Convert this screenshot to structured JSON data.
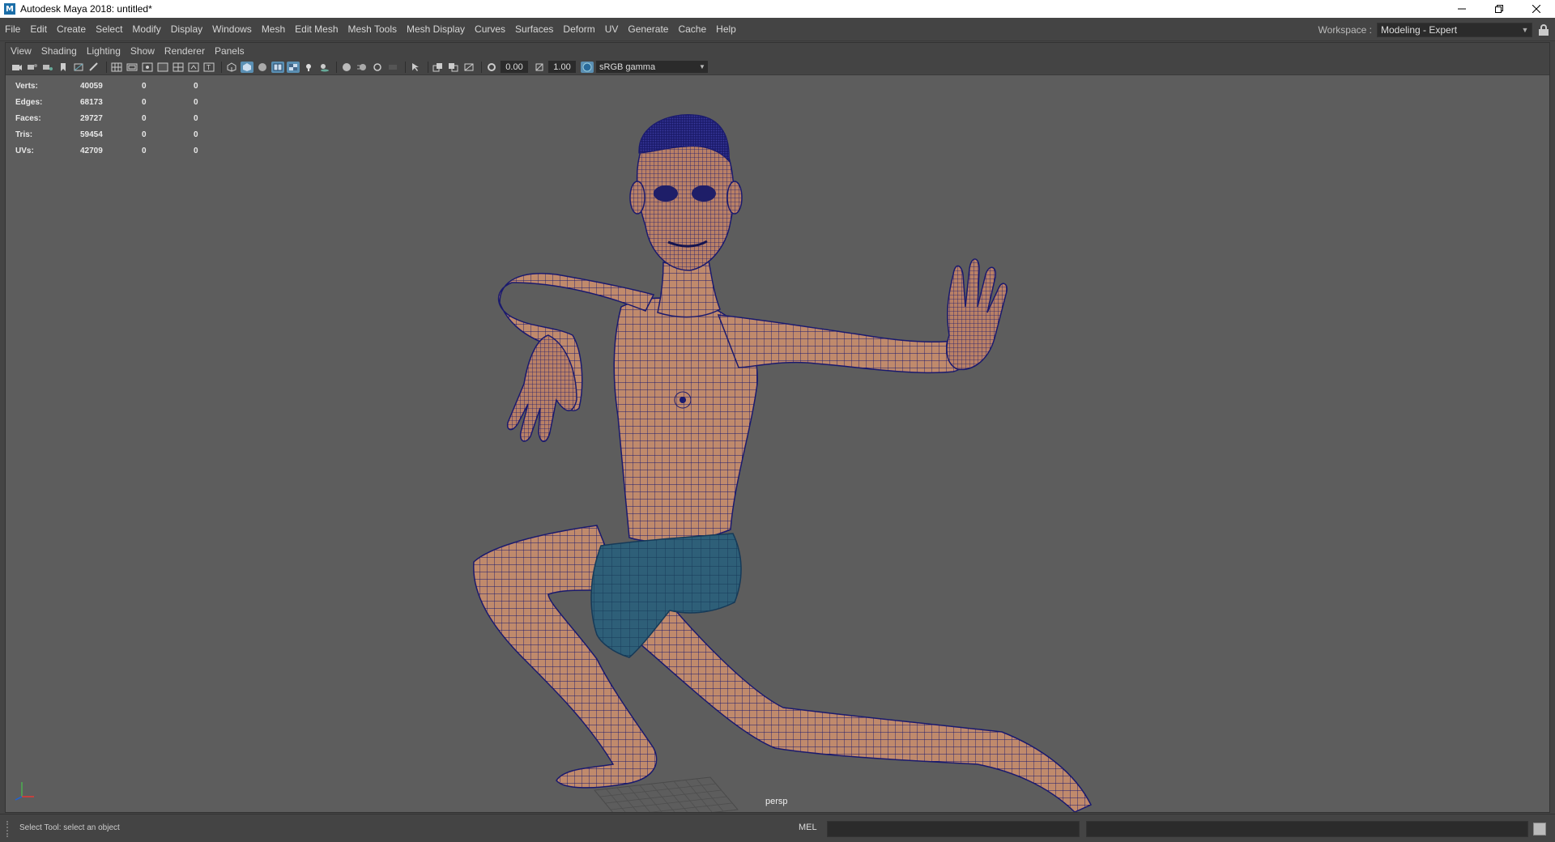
{
  "window": {
    "title": "Autodesk Maya 2018: untitled*",
    "app_icon_letter": "M",
    "controls": [
      "minimize",
      "restore",
      "close"
    ]
  },
  "main_menu": [
    "File",
    "Edit",
    "Create",
    "Select",
    "Modify",
    "Display",
    "Windows",
    "Mesh",
    "Edit Mesh",
    "Mesh Tools",
    "Mesh Display",
    "Curves",
    "Surfaces",
    "Deform",
    "UV",
    "Generate",
    "Cache",
    "Help"
  ],
  "workspace": {
    "label": "Workspace :",
    "value": "Modeling - Expert"
  },
  "panel_menu": [
    "View",
    "Shading",
    "Lighting",
    "Show",
    "Renderer",
    "Panels"
  ],
  "panel_toolbar": {
    "exposure": "0.00",
    "gamma": "1.00",
    "color_space": "sRGB gamma"
  },
  "hud": {
    "rows": [
      {
        "label": "Verts:",
        "values": [
          "40059",
          "0",
          "0"
        ]
      },
      {
        "label": "Edges:",
        "values": [
          "68173",
          "0",
          "0"
        ]
      },
      {
        "label": "Faces:",
        "values": [
          "29727",
          "0",
          "0"
        ]
      },
      {
        "label": "Tris:",
        "values": [
          "59454",
          "0",
          "0"
        ]
      },
      {
        "label": "UVs:",
        "values": [
          "42709",
          "0",
          "0"
        ]
      }
    ]
  },
  "viewport": {
    "camera": "persp",
    "background_color": "#5d5d5d",
    "mesh_skin_color": "#c08a6c",
    "mesh_wire_color": "#1a1a6e",
    "shorts_color": "#2e5f78"
  },
  "status": {
    "help_line": "Select Tool: select an object",
    "command_language": "MEL"
  }
}
